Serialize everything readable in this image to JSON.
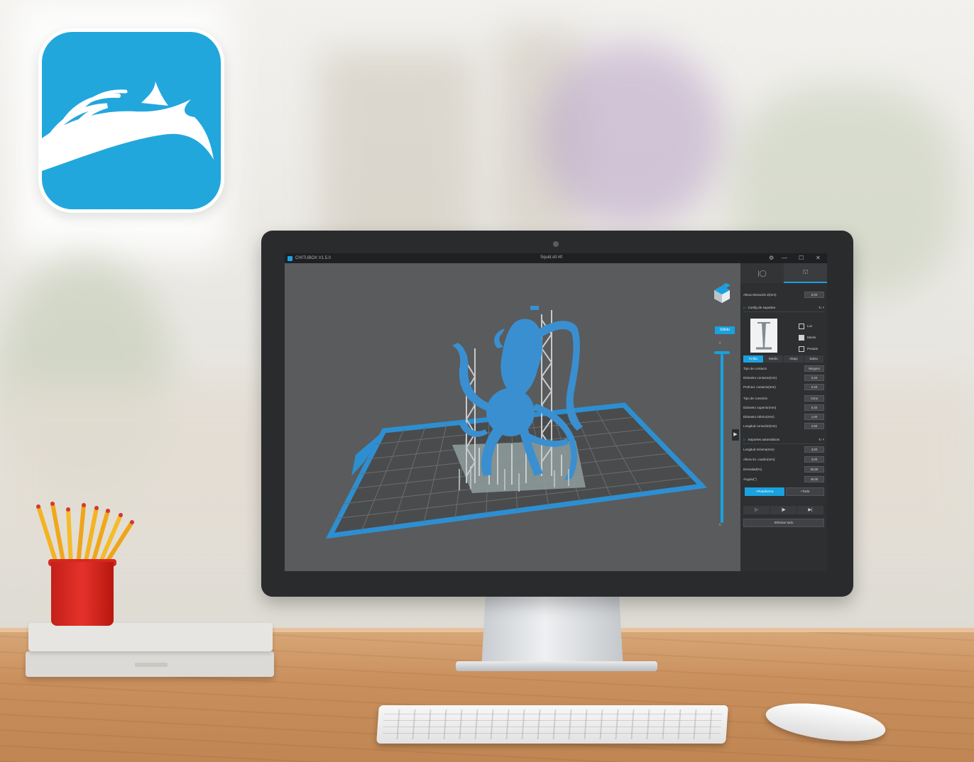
{
  "window": {
    "app_name": "CHITUBOX V1.5.0",
    "document_title": "Squid.stl #0",
    "controls": {
      "settings": "⚙",
      "minimize": "—",
      "maximize": "☐",
      "close": "✕"
    }
  },
  "viewport": {
    "render_mode_button": "Sólido",
    "slider_up_arrow": "˅",
    "slider_down_arrow": "˄",
    "panel_toggle": "▶"
  },
  "panel": {
    "tabs": [
      {
        "icon": "supports-tool-icon",
        "glyph": "|◯"
      },
      {
        "icon": "supports-config-icon",
        "glyph": "⛫"
      }
    ],
    "lift_height": {
      "label": "Altura elevación Z(mm)",
      "value": "5,00"
    },
    "support_config": {
      "header": "Config de soportes",
      "density_options": [
        {
          "label": "Luz",
          "checked": false
        },
        {
          "label": "Medio",
          "checked": true
        },
        {
          "label": "Pesado",
          "checked": false
        }
      ],
      "subtabs": [
        "Arriba",
        "Medio",
        "Abajo",
        "Balsa"
      ],
      "active_subtab": "Arriba",
      "rows": [
        {
          "label": "Tipo de contacto",
          "value": "Ninguno"
        },
        {
          "label": "Diámetro contacto(mm)",
          "value": "0,40"
        },
        {
          "label": "Profund. contacto(mm)",
          "value": "0,20"
        },
        {
          "label": "Tipo de conexión",
          "value": "Cono"
        },
        {
          "label": "Diámetro superior(mm)",
          "value": "0,40"
        },
        {
          "label": "Diámetro inferior(mm)",
          "value": "1,00"
        },
        {
          "label": "Longitud conexión(mm)",
          "value": "2,50"
        }
      ]
    },
    "auto_supports": {
      "header": "Soportes automáticos",
      "rows": [
        {
          "label": "Longitud mínima(mm)",
          "value": "3,00"
        },
        {
          "label": "Altura int. cuadro(mm)",
          "value": "3,00"
        },
        {
          "label": "Densidad(%)",
          "value": "50,00"
        },
        {
          "label": "Ángulo(°)",
          "value": "45,00"
        }
      ],
      "buttons": {
        "platform": "+Plataforma",
        "all": "+Todo"
      }
    },
    "play_buttons": [
      "▷",
      "|▶",
      "▶|"
    ],
    "delete_all": "Eliminar todo"
  },
  "colors": {
    "accent": "#1aa1df",
    "logo_bg": "#22a7dd",
    "model": "#3a8fd0",
    "plate_outline": "#2d8fd1",
    "panel_bg": "#2e2f31",
    "viewport_bg": "#5a5b5c"
  },
  "icons": {
    "logo": "chitubox-horse-logo",
    "view_cube": "view-cube-icon"
  }
}
